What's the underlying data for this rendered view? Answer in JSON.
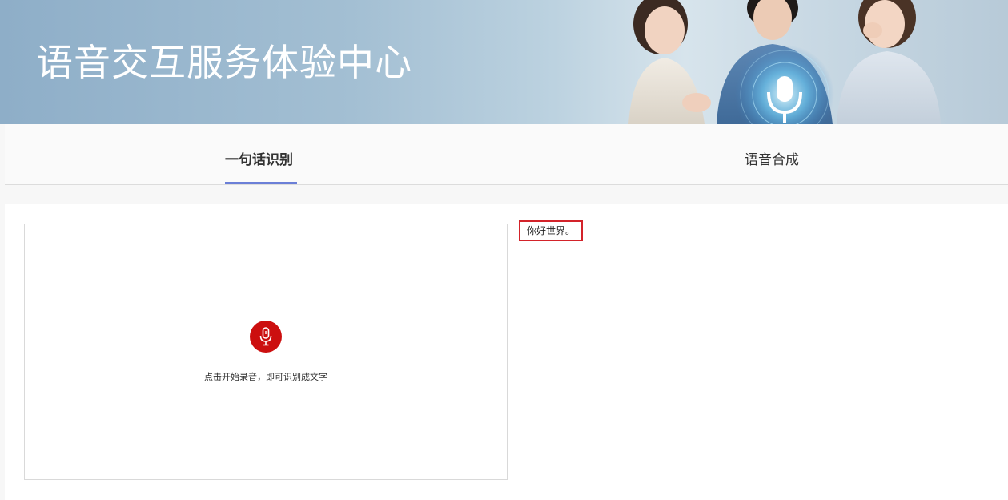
{
  "banner": {
    "title": "语音交互服务体验中心"
  },
  "tabs": [
    {
      "label": "一句话识别",
      "active": true
    },
    {
      "label": "语音合成",
      "active": false
    }
  ],
  "recorder": {
    "icon": "microphone-icon",
    "hint": "点击开始录音，即可识别成文字"
  },
  "result": {
    "text": "你好世界。"
  },
  "colors": {
    "accent_underline": "#6b7fd7",
    "mic_button": "#cc0f0f",
    "result_border": "#d3232a"
  }
}
